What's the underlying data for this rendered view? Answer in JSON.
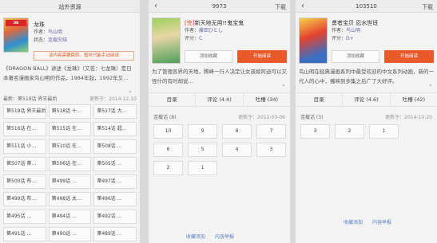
{
  "s1": {
    "title": "站外资源",
    "manga_title": "龙珠",
    "author_label": "作者：",
    "author": "鸟山明",
    "status_label": "状态：",
    "status": "连载完结",
    "notice": "该内容需要跳转，暂时只能手动阅读",
    "description": "《DRAGON BALL》讲述《龙珠》（又名：七龙珠）是日本著名漫画家鸟山明的作品，1984年起，1992年又…",
    "latest_label": "最新：第519话 界王最后",
    "date_label": "更新于：",
    "date": "2014-12-10",
    "chapters": [
      "第519话 界王最后",
      "第518话 十…",
      "第517话 大…",
      "第516话 在…",
      "第515话 在…",
      "第514话 超…",
      "第511话 小…",
      "第510话 在…",
      "第508话 …",
      "第507话 第…",
      "第506话 在…",
      "第505话 …",
      "第500话 布…",
      "第499话 …",
      "第497话 …",
      "第499话 布…",
      "第498话 太…",
      "第496话 …",
      "第495话 …",
      "第494话 …",
      "第492话 …",
      "第491话 …",
      "第490话 …",
      "第489话 …"
    ]
  },
  "s2": {
    "title": "9973",
    "download": "下载",
    "manga_title_tag": "[完]",
    "manga_title": "新天地无用!!鬼宝鬼",
    "author_label": "作者：",
    "author": "藤田ひとし",
    "status_label": "评分：",
    "status": "C",
    "add_favorite": "添加收藏",
    "start_reading": "开始阅读",
    "description": "为了管理各界的天地，腾峰一行人决定让女孩娘阿迪可以又怪什的有时胡说…",
    "tabs": [
      "目录",
      "评论 (4.4)",
      "吐槽 (34)"
    ],
    "section_label": "连载话 (8)",
    "date_label": "更新于：",
    "date": "2012-03-06",
    "chapters": [
      "10",
      "9",
      "8",
      "7",
      "6",
      "5",
      "4",
      "3",
      "2",
      "1"
    ],
    "link_add": "收藏添加",
    "link_content": "内容举报"
  },
  "s3": {
    "title": "103510",
    "download": "下载",
    "manga_title": "勇者宝贝 忍水世班",
    "author_label": "作者：",
    "author": "鸟山明",
    "status_label": "评分：",
    "status": "D+",
    "add_favorite": "添加收藏",
    "start_reading": "开始阅读",
    "description": "鸟山明在经典漫画系列中最受欢迎的中文系列动画，新的一代人的心中，播映到多集之后广了大好评。",
    "tabs": [
      "目录",
      "评论 (4.6)",
      "吐槽 (42)"
    ],
    "section_label": "连载话 (3)",
    "date_label": "更新于：",
    "date": "2014-10-20",
    "chapters": [
      "3",
      "2",
      "1"
    ],
    "link_add": "收藏添加",
    "link_content": "内容举报"
  }
}
